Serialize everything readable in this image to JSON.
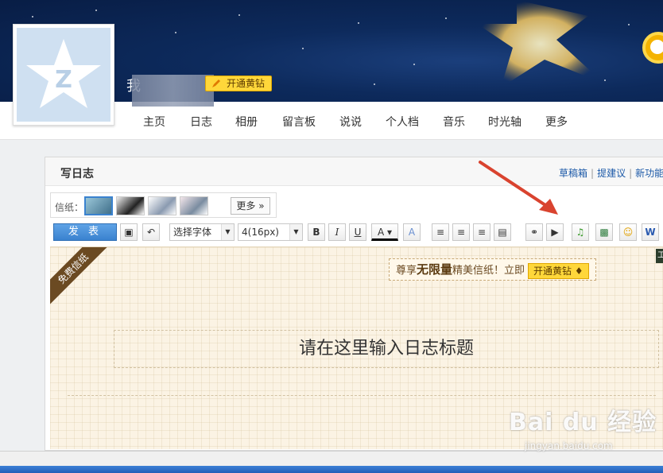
{
  "profile": {
    "name_visible_char": "我",
    "vip_label": "开通黄钻"
  },
  "nav": {
    "items": [
      "主页",
      "日志",
      "相册",
      "留言板",
      "说说",
      "个人档",
      "音乐",
      "时光轴",
      "更多"
    ]
  },
  "panel": {
    "title": "写日志",
    "links": [
      "草稿箱",
      "提建议",
      "新功能"
    ]
  },
  "stationery": {
    "label": "信纸：",
    "more_label": "更多"
  },
  "toolbar": {
    "publish_label": "发 表",
    "font_select": "选择字体",
    "size_select": "4(16px)",
    "bold": "B",
    "italic": "I",
    "underline": "U",
    "font_color": "A"
  },
  "editor": {
    "ribbon": "免费信纸",
    "promo_prefix": "尊享",
    "promo_bold": "无限量",
    "promo_suffix": "精美信纸！立即",
    "promo_button": "开通黄钻",
    "title_placeholder": "请在这里输入日志标题",
    "side_tag": "工"
  },
  "watermark": {
    "brand": "Bai du 经验",
    "url": "jingyan.baidu.com"
  },
  "colors": {
    "vip_yellow": "#ffd73a",
    "publish_blue": "#3a82cf",
    "link_blue": "#1d5aa8",
    "annotation_red": "#d9432f"
  }
}
